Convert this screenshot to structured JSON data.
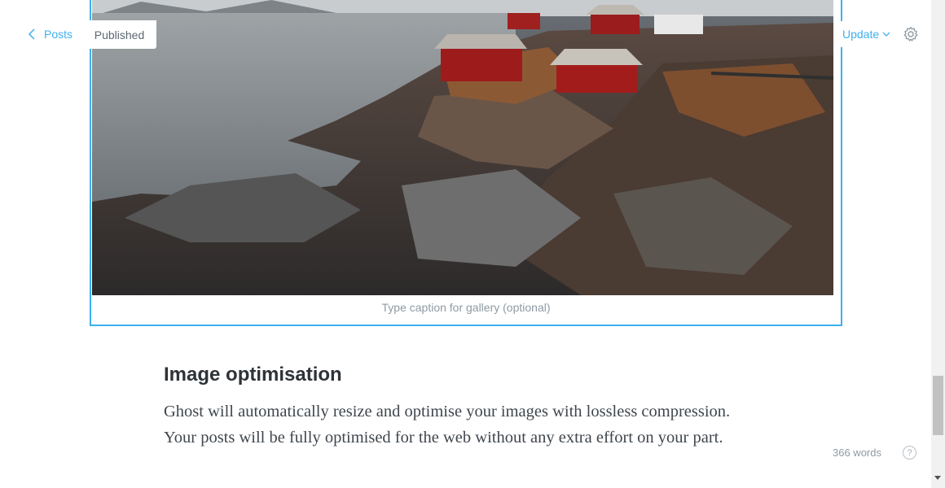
{
  "header": {
    "back_label": "Posts",
    "status": "Published",
    "update_label": "Update"
  },
  "gallery": {
    "caption_placeholder": "Type caption for gallery (optional)"
  },
  "content": {
    "heading": "Image optimisation",
    "paragraph": "Ghost will automatically resize and optimise your images with lossless compression. Your posts will be fully optimised for the web without any extra effort on your part."
  },
  "footer": {
    "word_count": "366 words",
    "help_label": "?"
  },
  "colors": {
    "accent": "#3eb0ef",
    "heading": "#2e3338",
    "body_text": "#3f464d",
    "muted": "#8f9aa3"
  }
}
